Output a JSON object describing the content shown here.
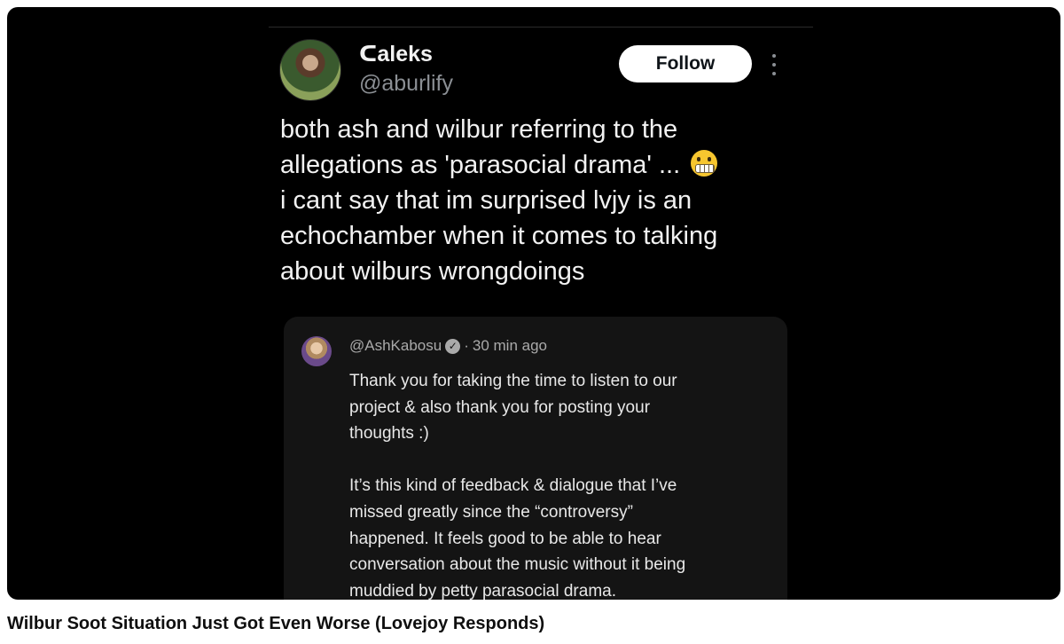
{
  "tweet": {
    "display_name": "ᑕaleks",
    "handle": "@aburlify",
    "follow_label": "Follow",
    "body_lines": [
      "both ash and wilbur referring to the",
      "allegations as 'parasocial drama' ...",
      "i cant say that im surprised lvjy is an",
      "echochamber when it comes to talking",
      "about wilburs wrongdoings"
    ],
    "emoji_icon": "grimacing-face-icon"
  },
  "reply": {
    "author": "@AshKabosu",
    "separator": "·",
    "time": "30 min ago",
    "verified_icon": "verified-check-icon",
    "lines": [
      "Thank you for taking the time to listen to our",
      "project & also thank you for posting your",
      "thoughts :)",
      "",
      "It’s this kind of feedback & dialogue that I’ve",
      "missed greatly since the “controversy”",
      "happened. It feels good to be able to hear",
      "conversation about the music without it being",
      "muddied by petty parasocial drama."
    ]
  },
  "video": {
    "title": "Wilbur Soot Situation Just Got Even Worse (Lovejoy Responds)"
  }
}
